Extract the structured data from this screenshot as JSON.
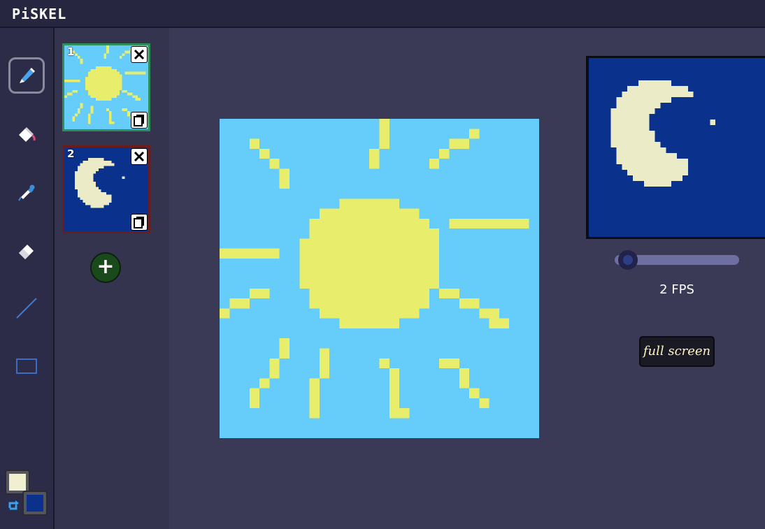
{
  "app": {
    "logo": "PiSKEL"
  },
  "tools": [
    {
      "name": "pen",
      "icon": "pen-icon",
      "selected": true
    },
    {
      "name": "paint-bucket",
      "icon": "paint-bucket-icon",
      "selected": false
    },
    {
      "name": "color-picker",
      "icon": "eyedropper-icon",
      "selected": false
    },
    {
      "name": "eraser",
      "icon": "eraser-icon",
      "selected": false
    },
    {
      "name": "line",
      "icon": "line-icon",
      "selected": false
    },
    {
      "name": "rectangle",
      "icon": "rectangle-icon",
      "selected": false
    }
  ],
  "frames": [
    {
      "number": "1",
      "selected": true
    },
    {
      "number": "2",
      "selected": false
    }
  ],
  "add_frame_label": "+",
  "colors": {
    "primary": "#f0f0d0",
    "secondary": "#0a318c",
    "sky": "#66ccfa",
    "sun": "#e8ee6c",
    "moon_bg": "#0a318c",
    "moon": "#ebebc8"
  },
  "preview": {
    "fps_value": 2,
    "fps_label": "2 FPS",
    "fullscreen_label": "full screen"
  }
}
